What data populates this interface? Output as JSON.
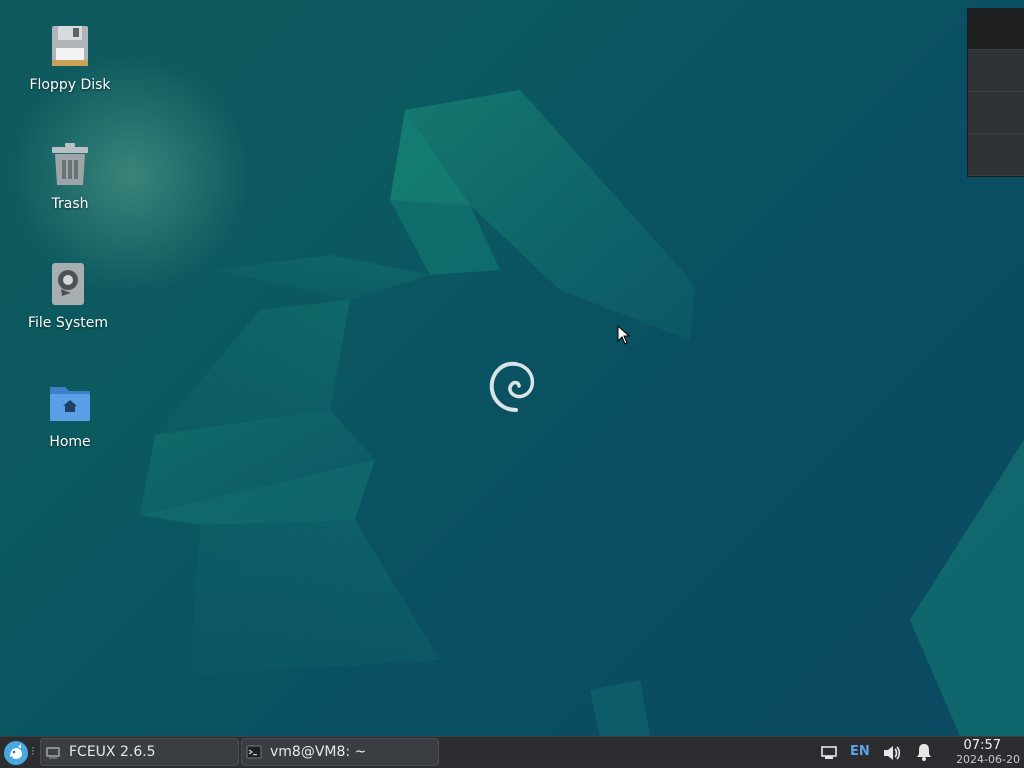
{
  "desktop": {
    "icons": [
      {
        "label": "Floppy Disk",
        "icon": "floppy-disk-icon"
      },
      {
        "label": "Trash",
        "icon": "trash-icon"
      },
      {
        "label": "File System",
        "icon": "hard-drive-icon"
      },
      {
        "label": "Home",
        "icon": "home-folder-icon"
      }
    ],
    "workspaces": {
      "count": 4,
      "active_index": 0
    }
  },
  "taskbar": {
    "tasks": [
      {
        "label": "FCEUX 2.6.5",
        "icon": "fceux-app-icon"
      },
      {
        "label": "vm8@VM8: ~",
        "icon": "terminal-icon"
      }
    ],
    "tray": {
      "network_icon": "network-wired-icon",
      "keyboard_layout": "EN",
      "volume_icon": "volume-icon",
      "notification_icon": "bell-icon"
    },
    "clock": {
      "time": "07:57",
      "date": "2024-06-20"
    }
  },
  "colors": {
    "desktop_base": "#0b5a60",
    "taskbar_bg": "#2b2d30",
    "keyboard_layout_accent": "#5aa3e8",
    "folder_blue": "#4a90d9"
  }
}
